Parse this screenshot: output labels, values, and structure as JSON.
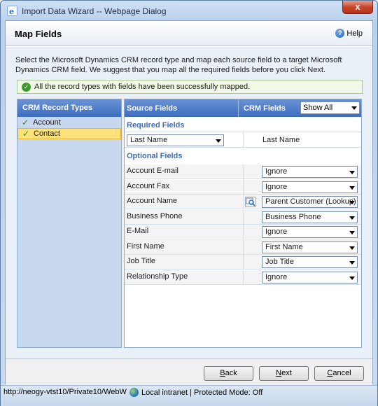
{
  "window": {
    "title": "Import Data Wizard -- Webpage Dialog",
    "close_label": "x"
  },
  "header": {
    "title": "Map Fields",
    "help_label": "Help"
  },
  "instructions": "Select the Microsoft Dynamics CRM record type and map each source field to a target Microsoft Dynamics CRM field. We suggest that you map all the required fields before you click Next.",
  "success_message": "All the record types with fields have been successfully mapped.",
  "record_types": {
    "header": "CRM Record Types",
    "items": [
      {
        "label": "Account",
        "selected": false
      },
      {
        "label": "Contact",
        "selected": true
      }
    ]
  },
  "mapping": {
    "source_header": "Source Fields",
    "crm_header": "CRM Fields",
    "filter_value": "Show All",
    "required_label": "Required Fields",
    "optional_label": "Optional Fields",
    "required_rows": [
      {
        "source": "Last Name",
        "crm": "Last Name"
      }
    ],
    "optional_rows": [
      {
        "source": "Account E-mail",
        "crm": "Ignore"
      },
      {
        "source": "Account Fax",
        "crm": "Ignore"
      },
      {
        "source": "Account Name",
        "crm": "Parent Customer (Lookup)",
        "lookup": true
      },
      {
        "source": "Business Phone",
        "crm": "Business Phone"
      },
      {
        "source": "E-Mail",
        "crm": "Ignore"
      },
      {
        "source": "First Name",
        "crm": "First Name"
      },
      {
        "source": "Job Title",
        "crm": "Job Title"
      },
      {
        "source": "Relationship Type",
        "crm": "Ignore"
      }
    ]
  },
  "footer": {
    "back_label": "Back",
    "back_key": "B",
    "back_rest": "ack",
    "next_label": "Next",
    "next_key": "N",
    "next_rest": "ext",
    "cancel_label": "Cancel",
    "cancel_key": "C",
    "cancel_rest": "ancel"
  },
  "status": {
    "url": "http://neogy-vtst10/Private10/WebW",
    "zone": "Local intranet | Protected Mode: Off"
  }
}
